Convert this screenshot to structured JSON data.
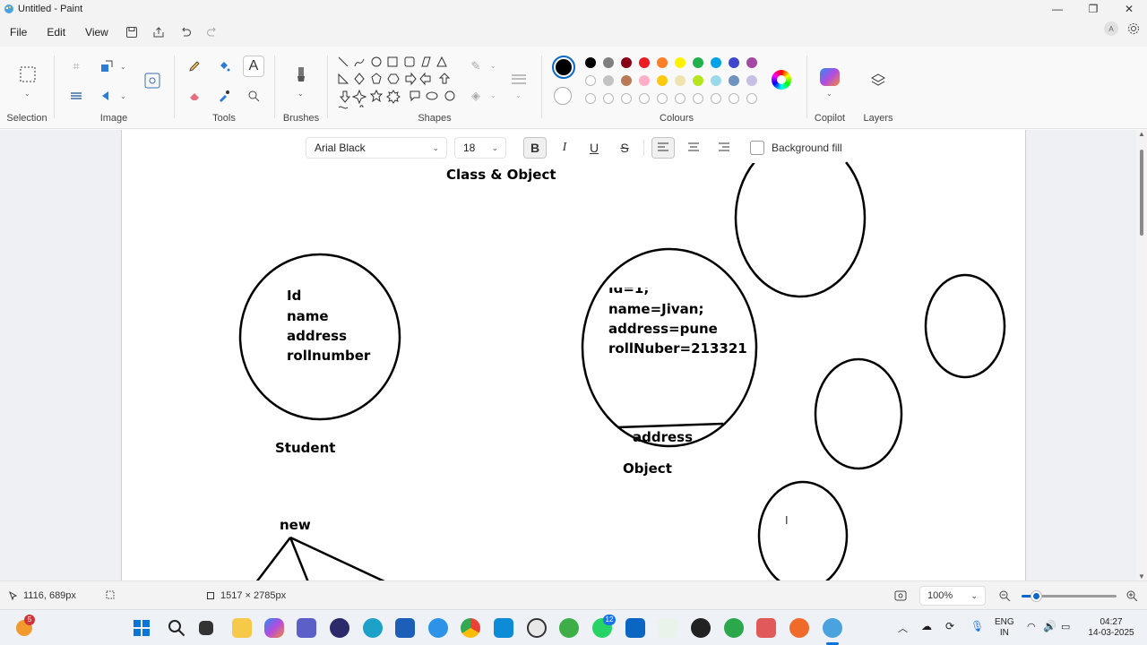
{
  "window": {
    "title": "Untitled - Paint"
  },
  "menu": {
    "items": [
      "File",
      "Edit",
      "View"
    ]
  },
  "ribbon": {
    "groups": {
      "selection": "Selection",
      "image": "Image",
      "tools": "Tools",
      "brushes": "Brushes",
      "shapes": "Shapes",
      "colours": "Colours",
      "copilot": "Copilot",
      "layers": "Layers"
    },
    "active_tool": "text-tool",
    "palette_row1": [
      "#000000",
      "#7f7f7f",
      "#880015",
      "#ed1c24",
      "#ff7f27",
      "#fff200",
      "#22b14c",
      "#00a2e8",
      "#3f48cc",
      "#a349a4"
    ],
    "palette_row2": [
      "#ffffff",
      "#c3c3c3",
      "#b97a57",
      "#ffaec9",
      "#ffc90e",
      "#efe4b0",
      "#b5e61d",
      "#99d9ea",
      "#7092be",
      "#c8bfe7"
    ],
    "primary_colour": "#000000",
    "secondary_colour": "#ffffff"
  },
  "text_toolbar": {
    "font": "Arial Black",
    "size": "18",
    "bold": "B",
    "italic": "I",
    "underline": "U",
    "strikethrough": "S",
    "background_fill_label": "Background fill"
  },
  "canvas": {
    "heading": "Class & Object",
    "class_fields": [
      "Id",
      "name",
      "address",
      "rollnumber"
    ],
    "class_caption": "Student",
    "object_fields": [
      "Id=1;",
      "name=Jivan;",
      "address=pune",
      "rollNuber=213321"
    ],
    "object_bottom": "address",
    "object_caption": "Object",
    "new_label": "new"
  },
  "status": {
    "cursor_pos": "1116, 689px",
    "canvas_size": "1517 × 2785px",
    "zoom": "100%",
    "zoom_level": 0.15
  },
  "taskbar": {
    "notification_badge": "5",
    "whatsapp_badge": "12",
    "lang_top": "ENG",
    "lang_bottom": "IN",
    "time": "04:27",
    "date": "14-03-2025"
  }
}
